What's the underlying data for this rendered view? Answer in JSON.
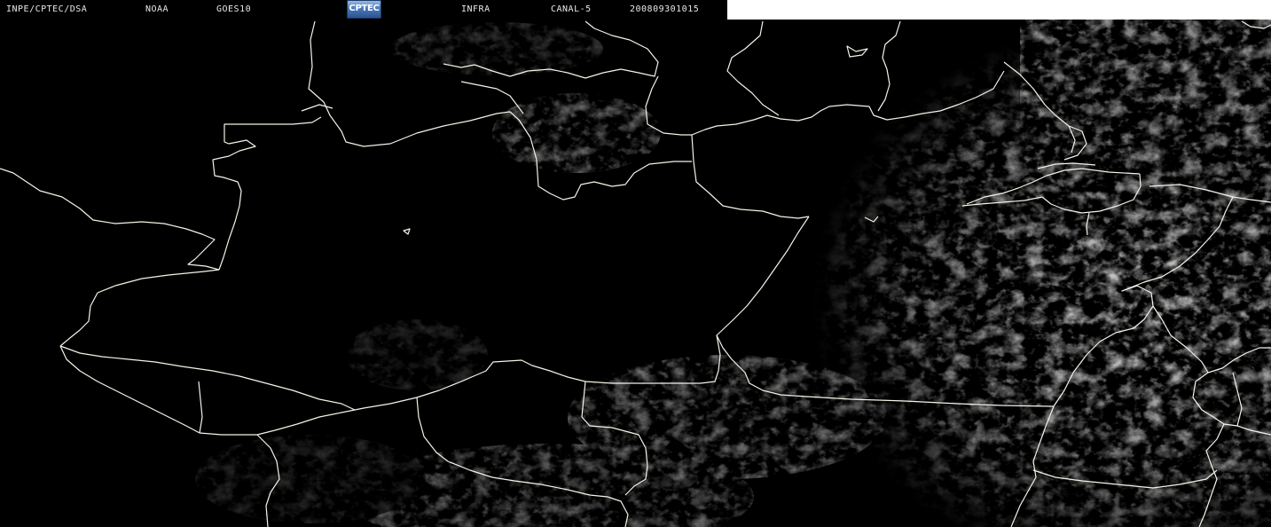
{
  "header": {
    "agency": "INPE/CPTEC/DSA",
    "source": "NOAA",
    "satellite": "GOES10",
    "logo_text": "CPTEC",
    "product": "INFRA",
    "channel": "CANAL-5",
    "timestamp": "200809301015"
  },
  "colors": {
    "background": "#000000",
    "boundary": "#f4f4e8",
    "cloud": "#9a9a9a",
    "header_text": "#e8e8e8",
    "logo_blue": "#4b79b8"
  },
  "icons": {
    "logo": "cptec-logo"
  }
}
